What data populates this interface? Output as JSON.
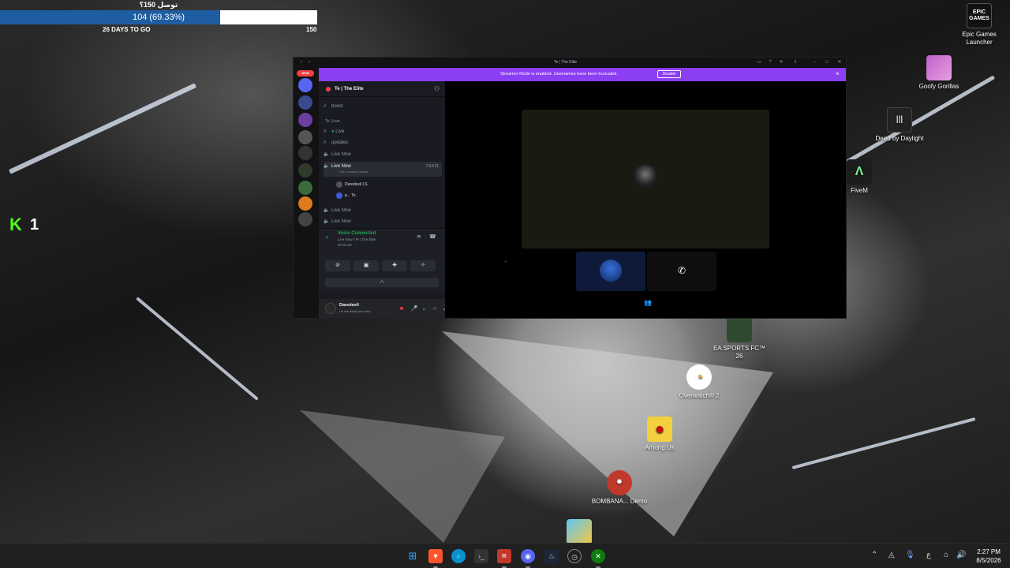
{
  "goal": {
    "title": "توصل 150؟",
    "value_text": "104 (69.33%)",
    "progress": 0.6933,
    "days_to_go": "26 DAYS TO GO",
    "max": "150"
  },
  "kick": {
    "logo": "K",
    "count": "1"
  },
  "desktop_icons": [
    {
      "label": "Epic Games Launcher",
      "icon": "epic-games-icon",
      "img_text": "EPIC GAMES"
    },
    {
      "label": "Goofy Gorillas",
      "icon": "goofy-gorillas-icon",
      "img_text": ""
    },
    {
      "label": "Dead by Daylight",
      "icon": "dead-by-daylight-icon",
      "img_text": ""
    },
    {
      "label": "FiveM",
      "icon": "fivem-icon",
      "img_text": ""
    },
    {
      "label": "EA SPORTS FC™ 26",
      "icon": "ea-sports-fc-icon",
      "img_text": ""
    },
    {
      "label": "Overwatch® 2",
      "icon": "overwatch-icon",
      "img_text": ""
    },
    {
      "label": "Among Us",
      "icon": "among-us-icon",
      "img_text": ""
    },
    {
      "label": "BOMBANA... Demo",
      "icon": "bombana-icon",
      "img_text": ""
    }
  ],
  "discord": {
    "window_title": "Te | The Elite",
    "new_badge": "NEW",
    "banner_text": "Streamer Mode is enabled. Usernames have been truncated.",
    "banner_button": "Disable",
    "guild_name": "Te | The Elite",
    "channels": {
      "boost": "boost",
      "category": "Te | Live",
      "live": "Live",
      "updates": "updates",
      "live_now_1": "Live Now",
      "live_now_active": "Live Now",
      "live_now_time": "7:54:31",
      "set_status": "Set a channel status",
      "member_1": "Daredevil",
      "member_1_badge": "LS",
      "member_2": "p...",
      "member_2_tag": "Te",
      "live_now_3": "Live Now",
      "live_now_4": "Live Now"
    },
    "voice": {
      "title": "Voice Connected",
      "subtitle": "Live Now / Te | The Elite",
      "elapsed": "07:31:23"
    },
    "user": {
      "name": "Daredevil",
      "status": "I'm the detail you retic..."
    }
  },
  "taskbar": {
    "time": "2:27 PM",
    "date": "8/5/2026",
    "lang": "ع"
  },
  "colors": {
    "discord_blurple": "#5865f2",
    "streamer_banner": "#8b3ef2",
    "voice_green": "#23a55a",
    "goal_fill": "#1f5da3",
    "kick_green": "#53fc18"
  }
}
